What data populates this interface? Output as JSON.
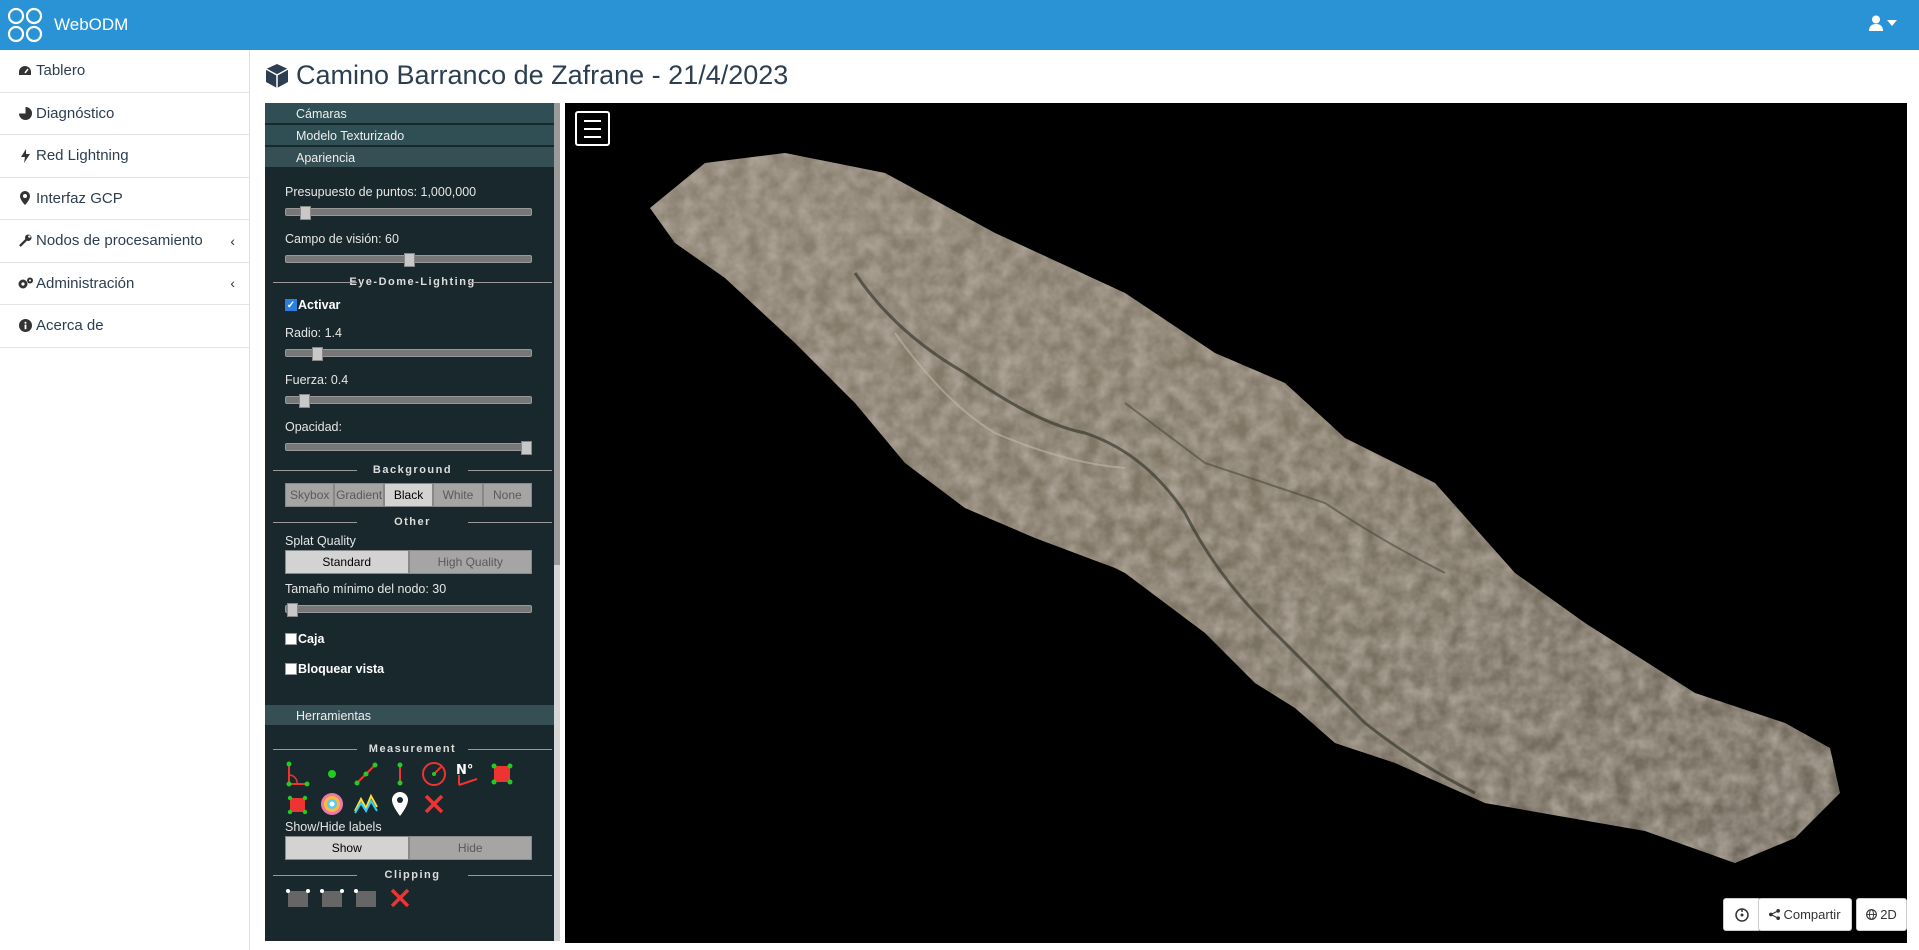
{
  "navbar": {
    "brand": "WebODM",
    "brand_color": "#2a93d5"
  },
  "sidebar": {
    "items": [
      {
        "label": "Tablero",
        "icon": "dashboard-icon"
      },
      {
        "label": "Diagnóstico",
        "icon": "pie-chart-icon"
      },
      {
        "label": "Red Lightning",
        "icon": "bolt-icon"
      },
      {
        "label": "Interfaz GCP",
        "icon": "map-marker-icon"
      },
      {
        "label": "Nodos de procesamiento",
        "icon": "wrench-icon",
        "has_submenu": true
      },
      {
        "label": "Administración",
        "icon": "cogs-icon",
        "has_submenu": true
      },
      {
        "label": "Acerca de",
        "icon": "info-icon"
      }
    ]
  },
  "page": {
    "title": "Camino Barranco de Zafrane - 21/4/2023"
  },
  "panel": {
    "sections": {
      "cameras": "Cámaras",
      "textured_model": "Modelo Texturizado",
      "appearance": "Apariencia",
      "tools": "Herramientas"
    },
    "point_budget": {
      "label": "Presupuesto de puntos: 1,000,000",
      "value": 0.09
    },
    "fov": {
      "label": "Campo de visión: 60",
      "value": 0.5
    },
    "edl_header": "Eye-Dome-Lighting",
    "edl_enable": {
      "label": "Activar",
      "checked": true
    },
    "radius": {
      "label": "Radio: 1.4",
      "value": 0.12
    },
    "strength": {
      "label": "Fuerza: 0.4",
      "value": 0.07
    },
    "opacity": {
      "label": "Opacidad:",
      "value": 1.0
    },
    "background_header": "Background",
    "background_options": [
      "Skybox",
      "Gradient",
      "Black",
      "White",
      "None"
    ],
    "background_selected": "Black",
    "other_header": "Other",
    "splat_quality": {
      "label": "Splat Quality",
      "options": [
        "Standard",
        "High Quality"
      ],
      "selected": "Standard"
    },
    "min_node_size": {
      "label": "Tamaño mínimo del nodo: 30",
      "value": 0.0
    },
    "box": {
      "label": "Caja",
      "checked": false
    },
    "lock_view": {
      "label": "Bloquear vista",
      "checked": false
    },
    "measurement_header": "Measurement",
    "labels": {
      "label": "Show/Hide labels",
      "options": [
        "Show",
        "Hide"
      ],
      "selected": "Show"
    },
    "clipping_header": "Clipping"
  },
  "viewer": {
    "share_label": "Compartir",
    "view2d_label": "2D"
  }
}
